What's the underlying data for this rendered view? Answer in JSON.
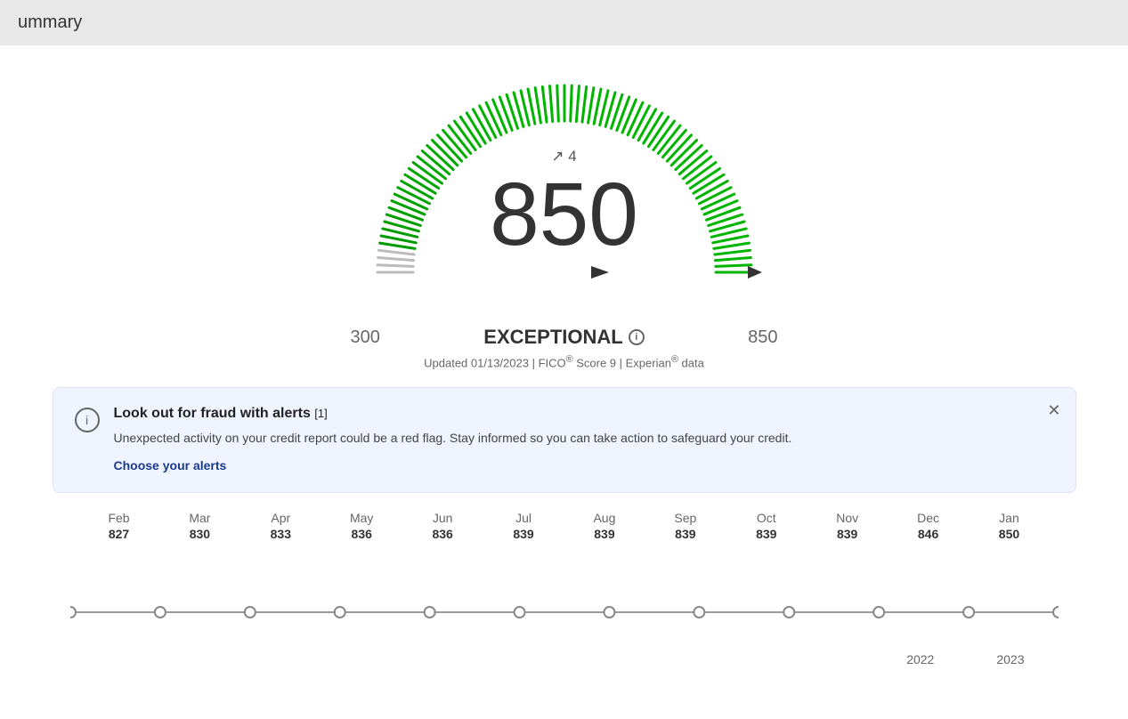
{
  "header": {
    "title": "ummary"
  },
  "gauge": {
    "score": "850",
    "change_arrow": "↗",
    "change_value": "4",
    "min": "300",
    "max": "850",
    "category": "EXCEPTIONAL",
    "updated_text": "Updated 01/13/2023 | FICO",
    "fico_sup": "®",
    "score_label": " Score 9 | Experian",
    "experian_sup": "®",
    "data_label": " data"
  },
  "alert": {
    "title": "Look out for fraud with alerts",
    "ref": "[1]",
    "body": "Unexpected activity on your credit report could be a red flag. Stay informed so you can take action to safeguard your credit.",
    "link": "Choose your alerts"
  },
  "chart": {
    "months": [
      {
        "month": "Feb",
        "score": "827"
      },
      {
        "month": "Mar",
        "score": "830"
      },
      {
        "month": "Apr",
        "score": "833"
      },
      {
        "month": "May",
        "score": "836"
      },
      {
        "month": "Jun",
        "score": "836"
      },
      {
        "month": "Jul",
        "score": "839"
      },
      {
        "month": "Aug",
        "score": "839"
      },
      {
        "month": "Sep",
        "score": "839"
      },
      {
        "month": "Oct",
        "score": "839"
      },
      {
        "month": "Nov",
        "score": "839"
      },
      {
        "month": "Dec",
        "score": "846"
      },
      {
        "month": "Jan",
        "score": "850"
      }
    ],
    "years": [
      "2022",
      "2023"
    ]
  }
}
